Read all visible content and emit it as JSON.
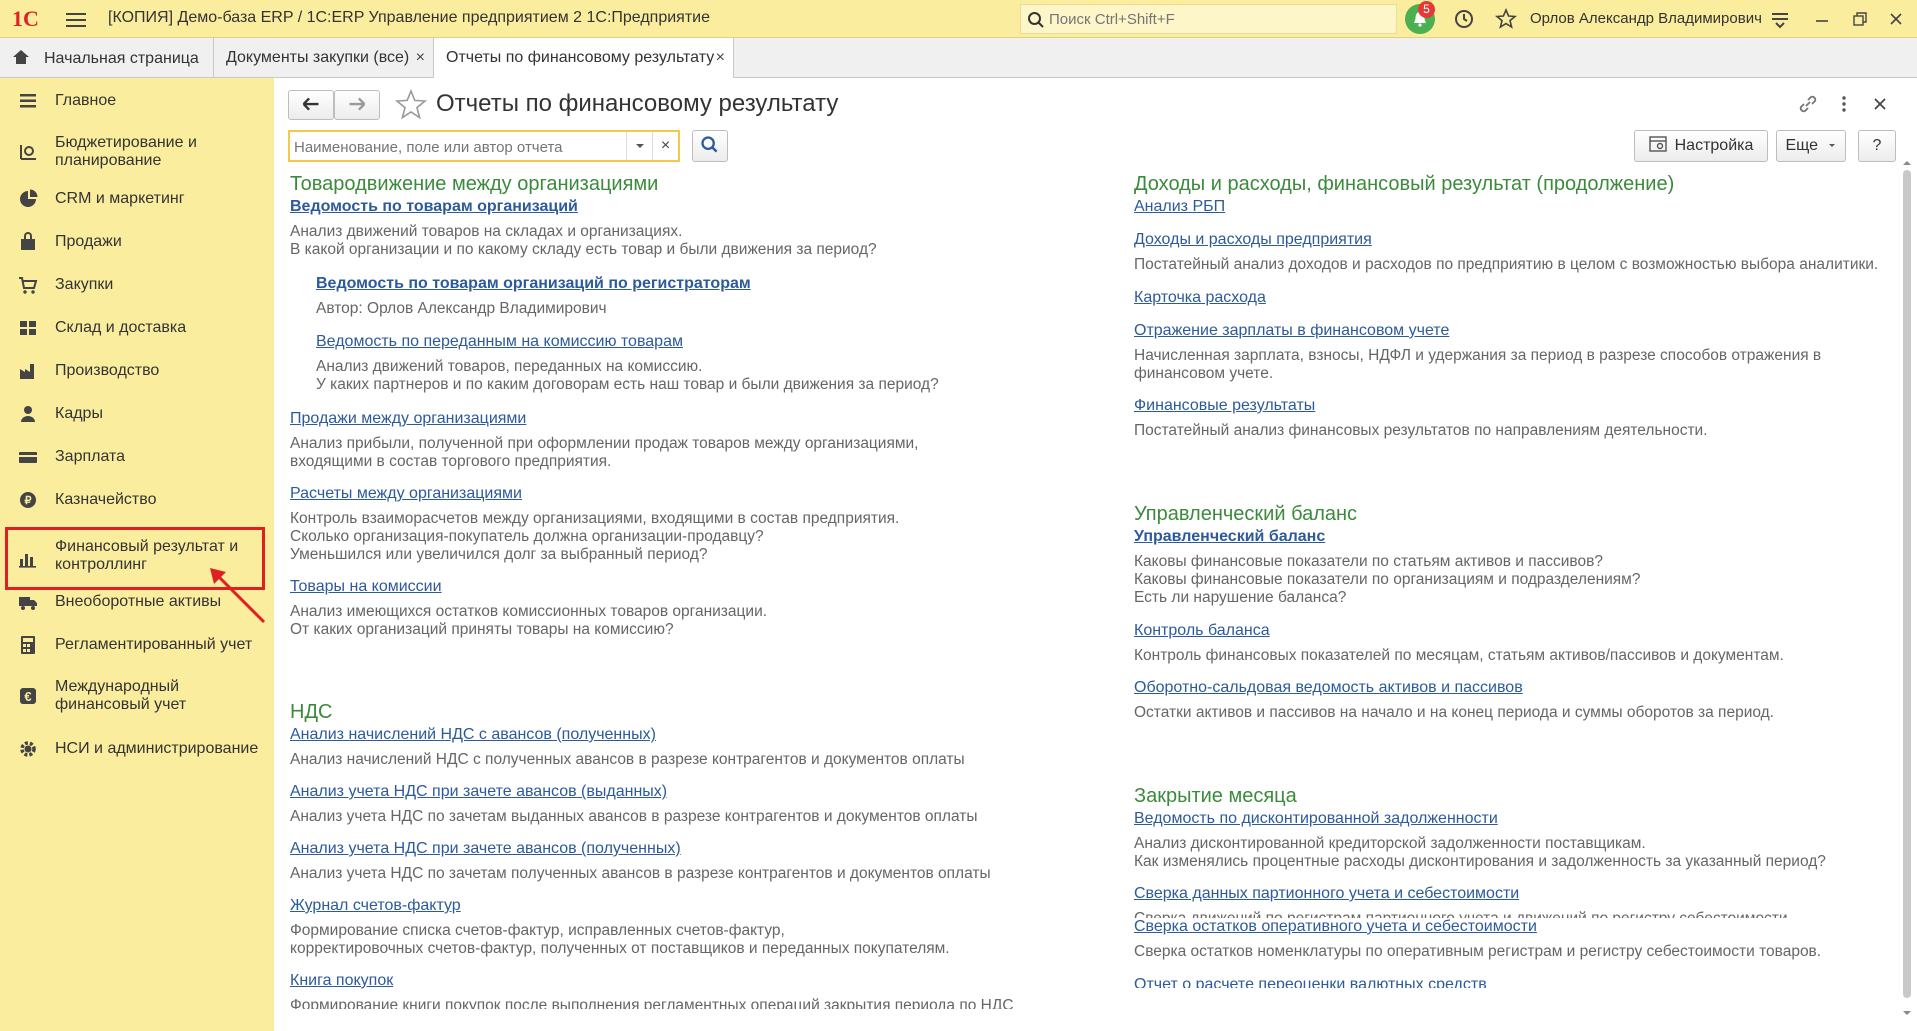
{
  "window": {
    "logo": "1С",
    "title": "[КОПИЯ] Демо-база ERP / 1С:ERP Управление предприятием 2 1С:Предприятие",
    "search_placeholder": "Поиск Ctrl+Shift+F",
    "notifications_count": "5",
    "user": "Орлов Александр Владимирович"
  },
  "tabs": [
    {
      "label": "Начальная страница"
    },
    {
      "label": "Документы закупки (все)"
    },
    {
      "label": "Отчеты по финансовому результату"
    }
  ],
  "tab_close": "×",
  "sidebar": [
    {
      "label": "Главное",
      "icon": "menu-lines-icon"
    },
    {
      "label": "Бюджетирование и планирование",
      "icon": "budget-icon"
    },
    {
      "label": "CRM и маркетинг",
      "icon": "crm-pie-icon"
    },
    {
      "label": "Продажи",
      "icon": "bag-icon"
    },
    {
      "label": "Закупки",
      "icon": "cart-icon"
    },
    {
      "label": "Склад и доставка",
      "icon": "warehouse-icon"
    },
    {
      "label": "Производство",
      "icon": "factory-icon"
    },
    {
      "label": "Кадры",
      "icon": "person-icon"
    },
    {
      "label": "Зарплата",
      "icon": "wallet-icon"
    },
    {
      "label": "Казначейство",
      "icon": "coin-icon"
    },
    {
      "label": "Финансовый результат и контроллинг",
      "icon": "bar-chart-icon"
    },
    {
      "label": "Внеоборотные активы",
      "icon": "truck-icon"
    },
    {
      "label": "Регламентированный учет",
      "icon": "calculator-icon"
    },
    {
      "label": "Международный финансовый учет",
      "icon": "euro-icon"
    },
    {
      "label": "НСИ и администрирование",
      "icon": "gear-icon"
    }
  ],
  "page": {
    "title": "Отчеты по финансовому результату",
    "filter_placeholder": "Наименование, поле или автор отчета",
    "settings_button": "Настройка",
    "more_button": "Еще",
    "help_button": "?",
    "clear": "×"
  },
  "left": {
    "s1_title": "Товародвижение между организациями",
    "s1_l1": "Ведомость по товарам организаций",
    "s1_d1a": "Анализ движений товаров на складах и организациях.",
    "s1_d1b": "В какой организации и по какому складу есть товар и были движения за период?",
    "s1_l2": "Ведомость по товарам организаций по регистраторам",
    "s1_d2": "Автор: Орлов Александр Владимирович",
    "s1_l3": "Ведомость по переданным на комиссию товарам",
    "s1_d3a": "Анализ движений товаров, переданных на комиссию.",
    "s1_d3b": "У каких партнеров и по каким договорам есть наш товар и были движения за период?",
    "s1_l4": "Продажи между организациями",
    "s1_d4a": "Анализ прибыли, полученной при оформлении продаж товаров между организациями,",
    "s1_d4b": "входящими в состав торгового предприятия.",
    "s1_l5": "Расчеты между организациями",
    "s1_d5a": "Контроль взаиморасчетов между организациями, входящими в состав предприятия.",
    "s1_d5b": "Сколько организация-покупатель должна организации-продавцу?",
    "s1_d5c": "Уменьшился или увеличился долг за выбранный период?",
    "s1_l6": "Товары на комиссии",
    "s1_d6a": "Анализ имеющихся остатков комиссионных товаров организации.",
    "s1_d6b": "От каких организаций приняты товары на комиссию?",
    "s2_title": "НДС",
    "s2_l1": "Анализ начислений НДС с авансов (полученных)",
    "s2_d1": "Анализ начислений НДС с полученных авансов в разрезе контрагентов и документов оплаты",
    "s2_l2": "Анализ учета НДС при зачете авансов (выданных)",
    "s2_d2": "Анализ учета НДС по зачетам выданных авансов в разрезе контрагентов и документов оплаты",
    "s2_l3": "Анализ учета НДС при зачете авансов (полученных)",
    "s2_d3": "Анализ учета НДС по зачетам полученных авансов в разрезе контрагентов и документов оплаты",
    "s2_l4": "Журнал счетов-фактур",
    "s2_d4a": "Формирование списка счетов-фактур, исправленных счетов-фактур,",
    "s2_d4b": "корректировочных счетов-фактур, полученных от поставщиков и переданных покупателям.",
    "s2_l5": "Книга покупок",
    "s2_d5": "Формирование книги покупок после выполнения регламентных операций закрытия периода по НДС"
  },
  "right": {
    "s1_title": "Доходы и расходы, финансовый результат (продолжение)",
    "s1_l1": "Анализ РБП",
    "s1_l2": "Доходы и расходы предприятия",
    "s1_d2": "Постатейный анализ доходов и расходов по предприятию в целом с возможностью выбора аналитики.",
    "s1_l3": "Карточка расхода",
    "s1_l4": "Отражение зарплаты в финансовом учете",
    "s1_d4a": "Начисленная зарплата, взносы, НДФЛ и удержания за период в разрезе способов отражения в",
    "s1_d4b": "финансовом учете.",
    "s1_l5": "Финансовые результаты",
    "s1_d5": "Постатейный анализ финансовых результатов по направлениям деятельности.",
    "s2_title": "Управленческий баланс",
    "s2_l1": "Управленческий баланс",
    "s2_d1a": "Каковы финансовые показатели по статьям активов и пассивов?",
    "s2_d1b": "Каковы финансовые показатели по организациям и подразделениям?",
    "s2_d1c": "Есть ли нарушение баланса?",
    "s2_l2": "Контроль баланса",
    "s2_d2": "Контроль финансовых показателей по месяцам, статьям активов/пассивов и документам.",
    "s2_l3": "Оборотно-сальдовая ведомость активов и пассивов",
    "s2_d3": "Остатки активов и пассивов на начало и на конец периода и суммы оборотов за период.",
    "s3_title": "Закрытие месяца",
    "s3_l1": "Ведомость по дисконтированной задолженности",
    "s3_d1a": "Анализ дисконтированной кредиторской задолженности поставщикам.",
    "s3_d1b": "Как изменялись процентные расходы дисконтирования и задолженность за указанный период?",
    "s3_l2": "Сверка данных партионного учета и себестоимости",
    "s3_d2": "Сверка движений по регистрам партионного учета и движений по регистру себестоимости.",
    "s3_l3": "Сверка остатков оперативного учета и себестоимости",
    "s3_d3": "Сверка остатков номенклатуры по оперативным регистрам и регистру себестоимости товаров.",
    "s3_l4": "Отчет о расчете переоценки валютных средств"
  }
}
